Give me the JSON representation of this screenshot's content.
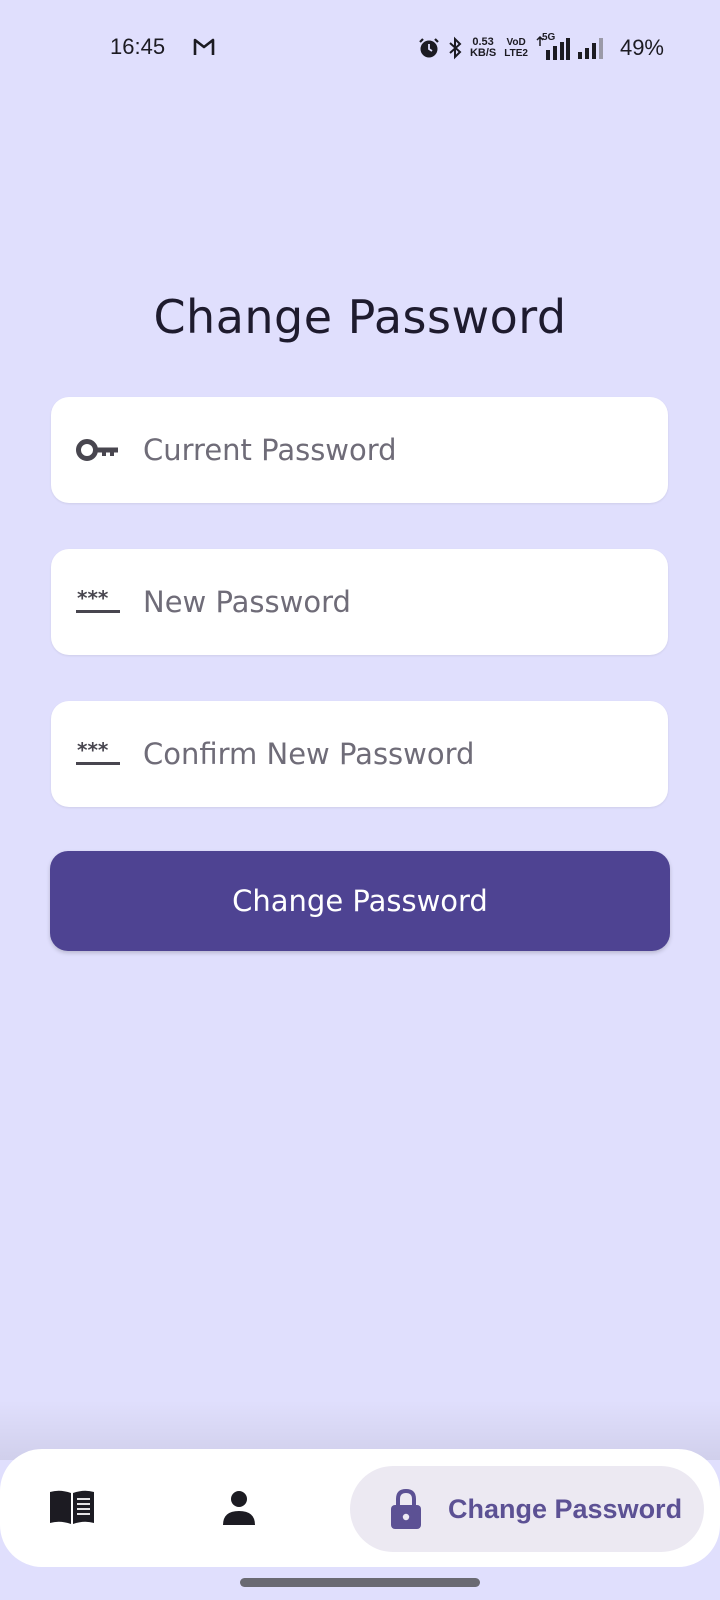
{
  "status_bar": {
    "time": "16:45",
    "net_speed_value": "0.53",
    "net_speed_unit": "KB/S",
    "volte_top": "VoD",
    "volte_bottom": "LTE2",
    "network_type": "5G",
    "battery": "49%"
  },
  "page": {
    "title": "Change Password"
  },
  "form": {
    "current_password": {
      "placeholder": "Current Password",
      "value": ""
    },
    "new_password": {
      "placeholder": "New Password",
      "value": ""
    },
    "confirm_password": {
      "placeholder": "Confirm New Password",
      "value": ""
    },
    "submit_label": "Change Password"
  },
  "bottom_nav": {
    "items": [
      {
        "icon": "book-icon",
        "active": false
      },
      {
        "icon": "person-icon",
        "active": false
      },
      {
        "icon": "lock-icon",
        "label": "Change Password",
        "active": true
      }
    ]
  },
  "colors": {
    "background": "#e0dffd",
    "primary": "#4e4392",
    "nav_active_bg": "#ece9f2",
    "nav_active_text": "#5c5194"
  }
}
